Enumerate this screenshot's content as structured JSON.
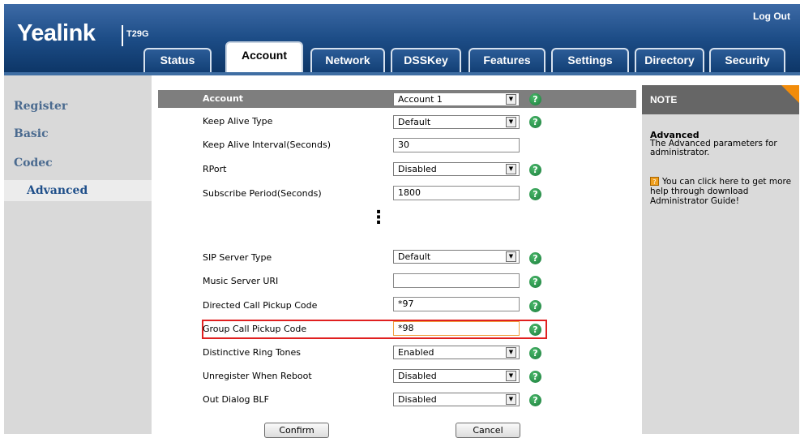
{
  "header": {
    "logo": "Yealink",
    "model": "T29G",
    "logout": "Log Out",
    "tabs": [
      {
        "label": "Status"
      },
      {
        "label": "Account"
      },
      {
        "label": "Network"
      },
      {
        "label": "DSSKey"
      },
      {
        "label": "Features"
      },
      {
        "label": "Settings"
      },
      {
        "label": "Directory"
      },
      {
        "label": "Security"
      }
    ],
    "active_tab": "Account"
  },
  "sidebar": {
    "items": [
      {
        "label": "Register"
      },
      {
        "label": "Basic"
      },
      {
        "label": "Codec"
      },
      {
        "label": "Advanced"
      }
    ],
    "active": "Advanced"
  },
  "form": {
    "account": {
      "label": "Account",
      "value": "Account 1"
    },
    "keep_alive_type": {
      "label": "Keep Alive Type",
      "value": "Default"
    },
    "keep_alive_interval": {
      "label": "Keep Alive Interval(Seconds)",
      "value": "30"
    },
    "rport": {
      "label": "RPort",
      "value": "Disabled"
    },
    "subscribe_period": {
      "label": "Subscribe Period(Seconds)",
      "value": "1800"
    },
    "sip_server_type": {
      "label": "SIP Server Type",
      "value": "Default"
    },
    "music_server_uri": {
      "label": "Music Server URI",
      "value": ""
    },
    "directed_call_pickup": {
      "label": "Directed Call Pickup Code",
      "value": "*97"
    },
    "group_call_pickup": {
      "label": "Group Call Pickup Code",
      "value": "*98"
    },
    "distinctive_ring": {
      "label": "Distinctive Ring Tones",
      "value": "Enabled"
    },
    "unregister_reboot": {
      "label": "Unregister When Reboot",
      "value": "Disabled"
    },
    "out_dialog_blf": {
      "label": "Out Dialog BLF",
      "value": "Disabled"
    },
    "help_glyph": "?",
    "ellipsis": "⋮",
    "confirm_label": "Confirm",
    "cancel_label": "Cancel"
  },
  "note": {
    "title": "NOTE",
    "advanced_title": "Advanced",
    "advanced_text": "The Advanced parameters for administrator.",
    "help_text": "You can click here to get more help through download Administrator Guide!"
  },
  "colors": {
    "header_blue": "#1d4d87",
    "help_green": "#1a7a3b",
    "highlight_red": "#e02020",
    "note_flag_orange": "#f28c0a"
  }
}
